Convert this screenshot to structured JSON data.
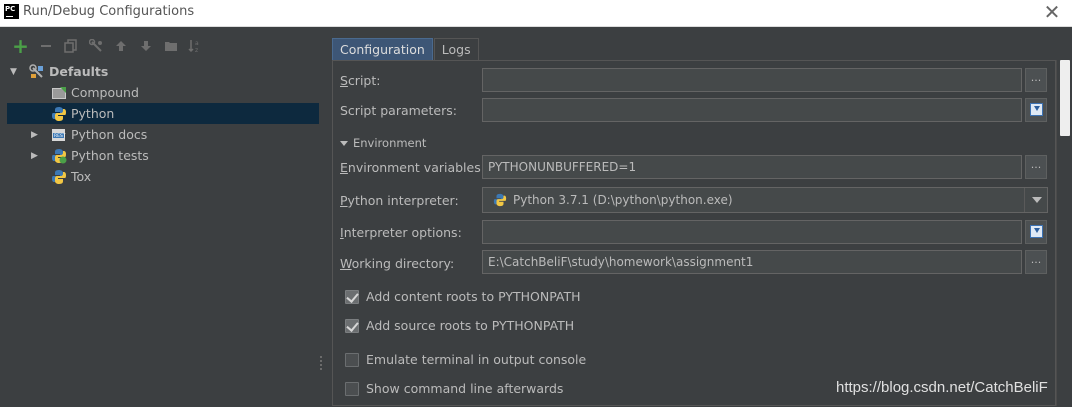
{
  "window": {
    "title": "Run/Debug Configurations",
    "app_icon_text": "PC",
    "close_glyph": "✕"
  },
  "toolbar": {
    "items": [
      "add-icon",
      "remove-icon",
      "copy-icon",
      "wrench-icon",
      "move-up-icon",
      "move-down-icon",
      "folder-icon",
      "sort-icon"
    ]
  },
  "tree": {
    "root": {
      "label": "Defaults",
      "expanded": true
    },
    "items": [
      {
        "label": "Compound",
        "icon": "compound-icon",
        "has_children": false,
        "selected": false
      },
      {
        "label": "Python",
        "icon": "python-icon",
        "has_children": false,
        "selected": true
      },
      {
        "label": "Python docs",
        "icon": "python-docs-icon",
        "has_children": true,
        "selected": false
      },
      {
        "label": "Python tests",
        "icon": "python-tests-icon",
        "has_children": true,
        "selected": false
      },
      {
        "label": "Tox",
        "icon": "tox-icon",
        "has_children": false,
        "selected": false
      }
    ]
  },
  "tabs": [
    {
      "label": "Configuration",
      "active": true
    },
    {
      "label": "Logs",
      "active": false
    }
  ],
  "form": {
    "script": {
      "label_mnemonic": "S",
      "label_rest": "cript:",
      "value": ""
    },
    "script_params": {
      "label": "Script parameters:",
      "value": ""
    },
    "environment_section": "Environment",
    "env_vars": {
      "label_mnemonic": "E",
      "label_rest": "nvironment variables:",
      "value": "PYTHONUNBUFFERED=1"
    },
    "interpreter": {
      "label_mnemonic": "P",
      "label_rest": "ython interpreter:",
      "value": "Python 3.7.1 (D:\\python\\python.exe)"
    },
    "interp_options": {
      "label_mnemonic": "I",
      "label_rest": "nterpreter options:",
      "value": ""
    },
    "working_dir": {
      "label_mnemonic": "W",
      "label_rest": "orking directory:",
      "value": "E:\\CatchBeliF\\study\\homework\\assignment1"
    },
    "dots_label": "...",
    "checkboxes": [
      {
        "label": "Add content roots to PYTHONPATH",
        "checked": true
      },
      {
        "label": "Add source roots to PYTHONPATH",
        "checked": true
      },
      {
        "label": "Emulate terminal in output console",
        "checked": false
      },
      {
        "label": "Show command line afterwards",
        "checked": false
      }
    ]
  },
  "watermark": "https://blog.csdn.net/CatchBeliF",
  "colors": {
    "background": "#3c3f41",
    "selection": "#0d293e",
    "active_tab": "#3d5676",
    "add_green": "#4ba048"
  }
}
